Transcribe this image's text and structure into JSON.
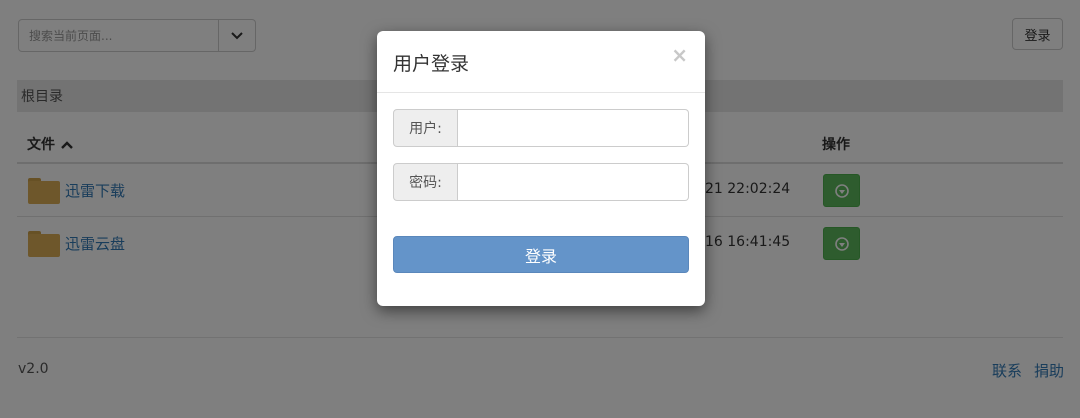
{
  "search": {
    "placeholder": "搜索当前页面..."
  },
  "header": {
    "login_label": "登录"
  },
  "breadcrumb": {
    "label": "根目录"
  },
  "table": {
    "col_file": "文件",
    "col_ops": "操作",
    "rows": [
      {
        "name": "迅雷下载",
        "time": "21 22:02:24"
      },
      {
        "name": "迅雷云盘",
        "time": "16 16:41:45"
      }
    ]
  },
  "footer": {
    "version": "v2.0",
    "contact": "联系",
    "donate": "捐助"
  },
  "modal": {
    "title": "用户登录",
    "close": "×",
    "user_label": "用户:",
    "pass_label": "密码:",
    "submit_label": "登录"
  },
  "colors": {
    "primary": "#337ab7",
    "success": "#5cb85c",
    "submit": "#6494c9",
    "folder": "#dcae57"
  }
}
